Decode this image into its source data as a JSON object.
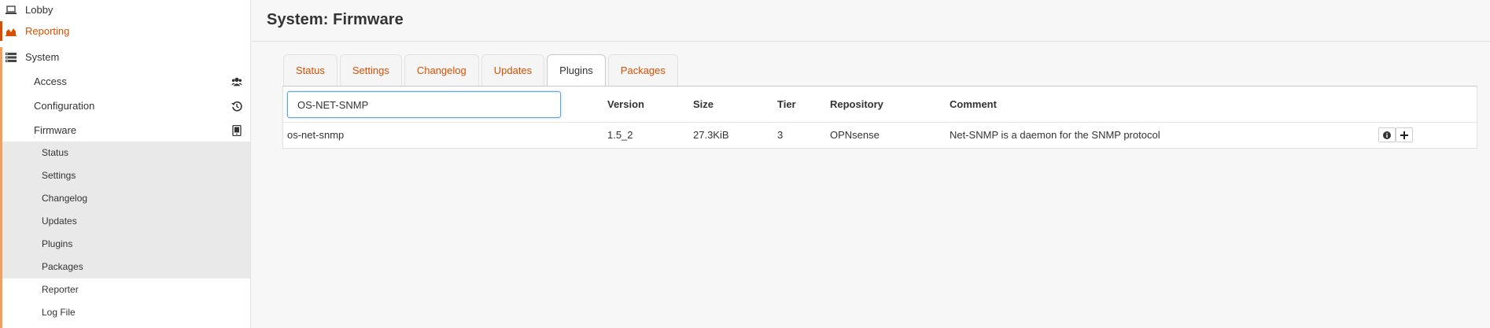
{
  "sidebar": {
    "lobby": "Lobby",
    "reporting": "Reporting",
    "system": "System",
    "access": "Access",
    "configuration": "Configuration",
    "firmware": "Firmware",
    "firmware_items": [
      "Status",
      "Settings",
      "Changelog",
      "Updates",
      "Plugins",
      "Packages"
    ],
    "reporter": "Reporter",
    "log_file": "Log File"
  },
  "header": {
    "title": "System: Firmware"
  },
  "tabs": [
    "Status",
    "Settings",
    "Changelog",
    "Updates",
    "Plugins",
    "Packages"
  ],
  "active_tab": "Plugins",
  "search": {
    "value": "OS-NET-SNMP"
  },
  "table": {
    "headers": [
      "Version",
      "Size",
      "Tier",
      "Repository",
      "Comment"
    ],
    "rows": [
      {
        "name": "os-net-snmp",
        "version": "1.5_2",
        "size": "27.3KiB",
        "tier": "3",
        "repository": "OPNsense",
        "comment": "Net-SNMP is a daemon for the SNMP protocol"
      }
    ]
  },
  "colors": {
    "accent": "#d94f00",
    "input_focus": "#5ca5d6",
    "submenu_bg": "#e9e9e9"
  }
}
